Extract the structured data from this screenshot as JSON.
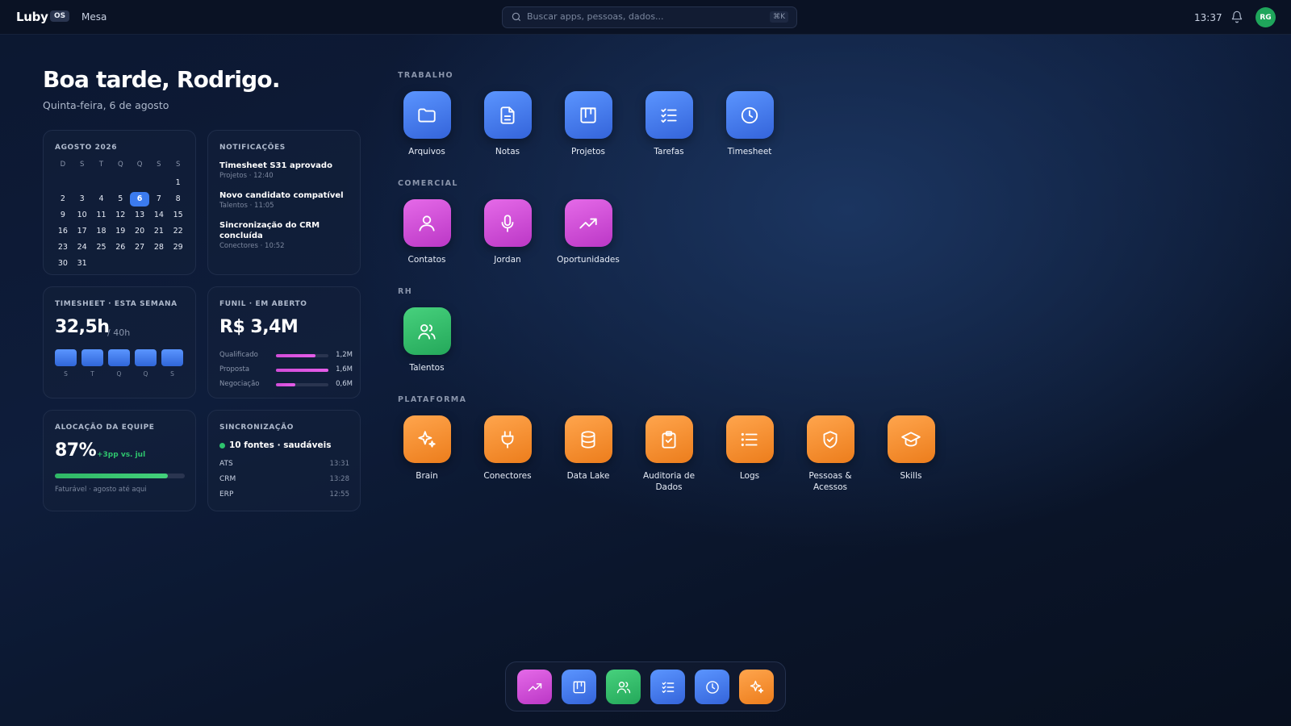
{
  "topbar": {
    "brand": "Luby",
    "os_badge": "OS",
    "mesa_label": "Mesa",
    "search_placeholder": "Buscar apps, pessoas, dados...",
    "search_shortcut": "⌘K",
    "clock": "13:37",
    "avatar_initials": "RG"
  },
  "greeting": {
    "title": "Boa tarde, Rodrigo.",
    "date": "Quinta-feira, 6 de agosto"
  },
  "calendar": {
    "title": "AGOSTO 2026",
    "weekdays": [
      "D",
      "S",
      "T",
      "Q",
      "Q",
      "S",
      "S"
    ],
    "weeks": [
      [
        "",
        "",
        "",
        "",
        "",
        "",
        "1"
      ],
      [
        "2",
        "3",
        "4",
        "5",
        "6",
        "7",
        "8"
      ],
      [
        "9",
        "10",
        "11",
        "12",
        "13",
        "14",
        "15"
      ],
      [
        "16",
        "17",
        "18",
        "19",
        "20",
        "21",
        "22"
      ],
      [
        "23",
        "24",
        "25",
        "26",
        "27",
        "28",
        "29"
      ],
      [
        "30",
        "31",
        "",
        "",
        "",
        "",
        ""
      ]
    ],
    "today": "6"
  },
  "notifications": {
    "title": "NOTIFICAÇÕES",
    "items": [
      {
        "title": "Timesheet S31 aprovado",
        "meta": "Projetos · 12:40"
      },
      {
        "title": "Novo candidato compatível",
        "meta": "Talentos · 11:05"
      },
      {
        "title": "Sincronização do CRM concluída",
        "meta": "Conectores · 10:52"
      }
    ]
  },
  "timesheet": {
    "title": "TIMESHEET · ESTA SEMANA",
    "hours": "32,5h",
    "of": "/ 40h",
    "days": [
      "S",
      "T",
      "Q",
      "Q",
      "S"
    ]
  },
  "funil": {
    "title": "FUNIL · EM ABERTO",
    "total": "R$ 3,4M",
    "stages": [
      {
        "label": "Qualificado",
        "value": "1,2M",
        "fraction": 0.75
      },
      {
        "label": "Proposta",
        "value": "1,6M",
        "fraction": 1.0
      },
      {
        "label": "Negociação",
        "value": "0,6M",
        "fraction": 0.37
      }
    ]
  },
  "alocacao": {
    "title": "ALOCAÇÃO DA EQUIPE",
    "value": "87%",
    "delta": "+3pp vs. jul",
    "fraction": 0.87,
    "note": "Faturável · agosto até aqui"
  },
  "sync": {
    "title": "SINCRONIZAÇÃO",
    "status": "10 fontes · saudáveis",
    "sources": [
      {
        "name": "ATS",
        "time": "13:31"
      },
      {
        "name": "CRM",
        "time": "13:28"
      },
      {
        "name": "ERP",
        "time": "12:55"
      }
    ]
  },
  "sections": {
    "trabalho": "TRABALHO",
    "comercial": "COMERCIAL",
    "rh": "RH",
    "plataforma": "PLATAFORMA"
  },
  "apps": {
    "trabalho": [
      {
        "label": "Arquivos",
        "icon": "folder-icon",
        "color": "#4a84f5"
      },
      {
        "label": "Notas",
        "icon": "document-icon",
        "color": "#4a84f5"
      },
      {
        "label": "Projetos",
        "icon": "kanban-icon",
        "color": "#4a84f5"
      },
      {
        "label": "Tarefas",
        "icon": "checklist-icon",
        "color": "#4a84f5"
      },
      {
        "label": "Timesheet",
        "icon": "clock-icon",
        "color": "#4a84f5"
      }
    ],
    "comercial": [
      {
        "label": "Contatos",
        "icon": "user-icon",
        "color": "#d452da"
      },
      {
        "label": "Jordan",
        "icon": "microphone-icon",
        "color": "#d452da"
      },
      {
        "label": "Oportunidades",
        "icon": "trend-up-icon",
        "color": "#d452da"
      }
    ],
    "rh": [
      {
        "label": "Talentos",
        "icon": "users-icon",
        "color": "#35be6c"
      }
    ],
    "plataforma": [
      {
        "label": "Brain",
        "icon": "sparkle-icon",
        "color": "#f59132"
      },
      {
        "label": "Conectores",
        "icon": "plug-icon",
        "color": "#f59132"
      },
      {
        "label": "Data Lake",
        "icon": "database-icon",
        "color": "#f59132"
      },
      {
        "label": "Auditoria de Dados",
        "icon": "clipboard-check-icon",
        "color": "#f59132"
      },
      {
        "label": "Logs",
        "icon": "list-icon",
        "color": "#f59132"
      },
      {
        "label": "Pessoas & Acessos",
        "icon": "shield-check-icon",
        "color": "#f59132"
      },
      {
        "label": "Skills",
        "icon": "graduation-cap-icon",
        "color": "#f59132"
      }
    ]
  },
  "dock": [
    {
      "icon": "trend-up-icon",
      "color": "#d452da"
    },
    {
      "icon": "kanban-icon",
      "color": "#4a84f5"
    },
    {
      "icon": "users-icon",
      "color": "#35be6c"
    },
    {
      "icon": "checklist-icon",
      "color": "#4a84f5"
    },
    {
      "icon": "clock-icon",
      "color": "#4a84f5"
    },
    {
      "icon": "sparkle-icon",
      "color": "#f59132"
    }
  ]
}
